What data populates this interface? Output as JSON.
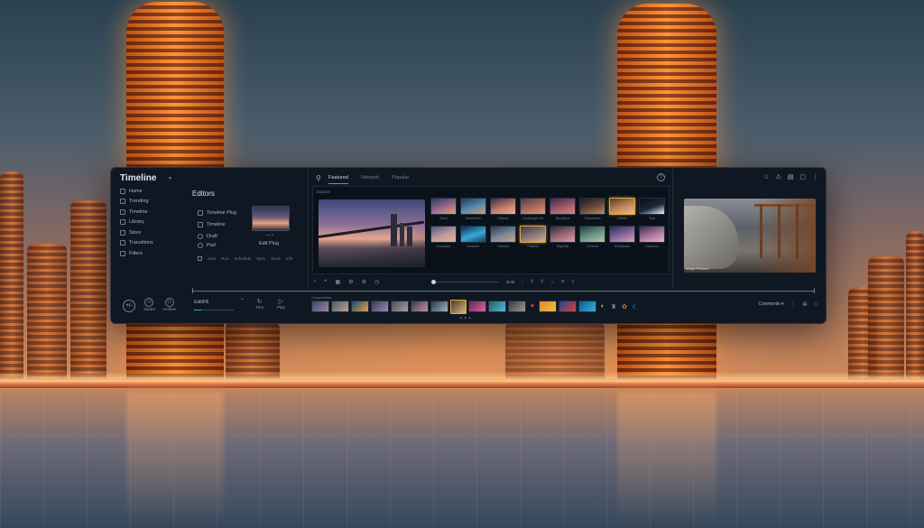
{
  "app": {
    "title": "Timeline"
  },
  "sidebar": {
    "items": [
      {
        "label": "Home",
        "icon": "home-icon"
      },
      {
        "label": "Trending",
        "icon": "trending-icon"
      },
      {
        "label": "Timeline",
        "icon": "timeline-icon"
      },
      {
        "label": "Library",
        "icon": "library-icon"
      },
      {
        "label": "Store",
        "icon": "store-icon"
      },
      {
        "label": "Transitions",
        "icon": "transitions-icon"
      },
      {
        "label": "Filters",
        "icon": "filters-icon"
      }
    ]
  },
  "editor": {
    "title": "Editors",
    "items": [
      "Timeline Plug",
      "Timeline",
      "Draft",
      "Pad"
    ],
    "thumb_label": "Edit Plug",
    "dots": "• • •",
    "options": [
      "Auto",
      "Run",
      "Schedule",
      "Sync",
      "Tools",
      "Info"
    ]
  },
  "center": {
    "tabs": [
      {
        "label": "Featured",
        "active": true
      },
      {
        "label": "Network",
        "active": false
      },
      {
        "label": "Popular",
        "active": false
      }
    ],
    "media_label": "Explore",
    "grid": [
      {
        "label": "Cloud",
        "colors": [
          "#2b3a5a",
          "#9a6a8a",
          "#e8a070"
        ],
        "selected": false
      },
      {
        "label": "Adventure",
        "colors": [
          "#1f3a5a",
          "#5a8ab0",
          "#d89a6a"
        ],
        "selected": false
      },
      {
        "label": "Hillside",
        "colors": [
          "#3a2a3a",
          "#c07a6a",
          "#f0b08a"
        ],
        "selected": false
      },
      {
        "label": "Landscape 24",
        "colors": [
          "#4a3a4a",
          "#b06a5a",
          "#e09a7a"
        ],
        "selected": false
      },
      {
        "label": "Storytime",
        "colors": [
          "#3a2a4a",
          "#a05a6a",
          "#d88a7a"
        ],
        "selected": false
      },
      {
        "label": "Characters",
        "colors": [
          "#1a1a22",
          "#6a4a3a",
          "#c08a6a"
        ],
        "selected": false
      },
      {
        "label": "Artists",
        "colors": [
          "#5a3a2a",
          "#c08a5a",
          "#e8c08a"
        ],
        "selected": true
      },
      {
        "label": "Trail",
        "colors": [
          "#0a0e14",
          "#1a2a3a",
          "#e8f0ff"
        ],
        "selected": false
      },
      {
        "label": "Exclusive",
        "colors": [
          "#4a5a7a",
          "#c09aa0",
          "#e8b090"
        ],
        "selected": false
      },
      {
        "label": "Summer",
        "colors": [
          "#0a2a4a",
          "#3aa8d8",
          "#1a3a5a"
        ],
        "selected": false
      },
      {
        "label": "Cinema",
        "colors": [
          "#2a3a4a",
          "#7a8a9a",
          "#d0a080"
        ],
        "selected": false
      },
      {
        "label": "Portrait",
        "colors": [
          "#3a3a4a",
          "#8a7a7a",
          "#d8b090"
        ],
        "selected": true
      },
      {
        "label": "Nightfall",
        "colors": [
          "#2a2a3a",
          "#a06a7a",
          "#e0a0a0"
        ],
        "selected": false
      },
      {
        "label": "Camera",
        "colors": [
          "#2a3a3a",
          "#6a9a8a",
          "#c0c0a0"
        ],
        "selected": false
      },
      {
        "label": "Showcase",
        "colors": [
          "#2a2a4a",
          "#8a6aa0",
          "#e0a0b0"
        ],
        "selected": false
      },
      {
        "label": "Graphics",
        "colors": [
          "#3a2a4a",
          "#b07aa0",
          "#f0b0c0"
        ],
        "selected": false
      }
    ],
    "controls": [
      "‹",
      "+",
      "▦",
      "⚙",
      "⚙",
      "◷"
    ],
    "right_controls": [
      "Bold",
      "‹",
      "⚲",
      "⚲",
      "♫",
      "✉",
      "▯"
    ]
  },
  "right": {
    "icons": [
      "☆",
      "⚠",
      "▤",
      "▢",
      "⋮"
    ],
    "preview_caption": "Image Preview"
  },
  "bottom": {
    "add_label": "+/-",
    "left_buttons": [
      {
        "label": "Saved",
        "icon": "⚇"
      },
      {
        "label": "Archive",
        "icon": "⚇"
      }
    ],
    "edit_label": "Edit/Fill",
    "mid_buttons": [
      {
        "label": "Turn",
        "icon": "↻"
      },
      {
        "label": "Play",
        "icon": "▷"
      }
    ],
    "strip_label": "Composition",
    "strip_sub": "▲ ▲ ▲",
    "strip": [
      {
        "kind": "thumb",
        "colors": [
          "#3a4a6a",
          "#a080a0"
        ]
      },
      {
        "kind": "thumb",
        "colors": [
          "#4a5a6a",
          "#c0a090"
        ]
      },
      {
        "kind": "thumb",
        "colors": [
          "#1a4a6a",
          "#e0a050"
        ]
      },
      {
        "kind": "thumb",
        "colors": [
          "#3a3a5a",
          "#9a8ab0"
        ]
      },
      {
        "kind": "thumb",
        "colors": [
          "#4a4a5a",
          "#b0a0a0"
        ]
      },
      {
        "kind": "thumb",
        "colors": [
          "#3a3a4a",
          "#c090a0"
        ]
      },
      {
        "kind": "thumb",
        "colors": [
          "#2a3a4a",
          "#a0b0c0"
        ]
      },
      {
        "kind": "thumb",
        "colors": [
          "#4a3a2a",
          "#e0b080"
        ],
        "selected": true
      },
      {
        "kind": "thumb",
        "colors": [
          "#5a2a5a",
          "#e060a0"
        ]
      },
      {
        "kind": "thumb",
        "colors": [
          "#2a5a6a",
          "#50c0d0"
        ]
      },
      {
        "kind": "thumb",
        "colors": [
          "#3a3a3a",
          "#9a9a9a"
        ]
      },
      {
        "kind": "icon",
        "glyph": "♥",
        "color": "#e23a3a"
      },
      {
        "kind": "thumb",
        "colors": [
          "#e08a2a",
          "#f0c040"
        ]
      },
      {
        "kind": "thumb",
        "colors": [
          "#1a4a8a",
          "#e04040"
        ]
      },
      {
        "kind": "thumb",
        "colors": [
          "#0a5a8a",
          "#3ab0e0"
        ]
      },
      {
        "kind": "icon",
        "glyph": "◐",
        "color": "#c0c8d0"
      },
      {
        "kind": "icon",
        "glyph": "♜",
        "color": "#7a8a9a"
      },
      {
        "kind": "icon",
        "glyph": "✿",
        "color": "#d07a3a"
      },
      {
        "kind": "icon",
        "glyph": "☾",
        "color": "#4a9ad8"
      }
    ],
    "right_label": "Comments",
    "right_icons": [
      "⋮",
      "▤",
      "▢"
    ]
  }
}
